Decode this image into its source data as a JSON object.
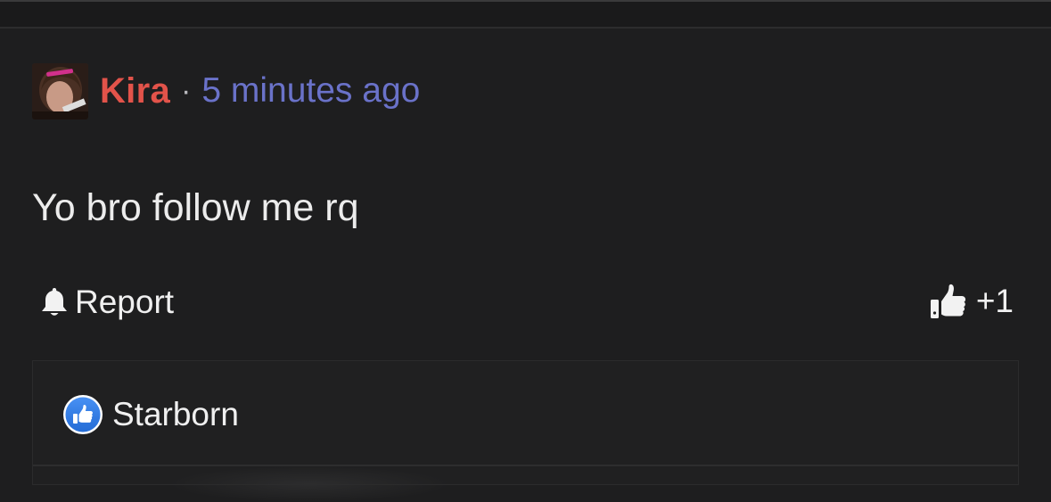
{
  "comment": {
    "author": "Kira",
    "separator": "·",
    "time": "5 minutes ago",
    "text": "Yo bro follow me rq",
    "report_label": "Report",
    "like_count": "+1",
    "avatar_icon": "user-photo-avatar"
  },
  "reactions": {
    "items": [
      {
        "user": "Starborn",
        "icon": "thumbs-up-badge-icon"
      }
    ]
  },
  "colors": {
    "background": "#1e1e1f",
    "author": "#e2534a",
    "timestamp": "#6a72c9",
    "like_badge": "#2f7be5"
  }
}
